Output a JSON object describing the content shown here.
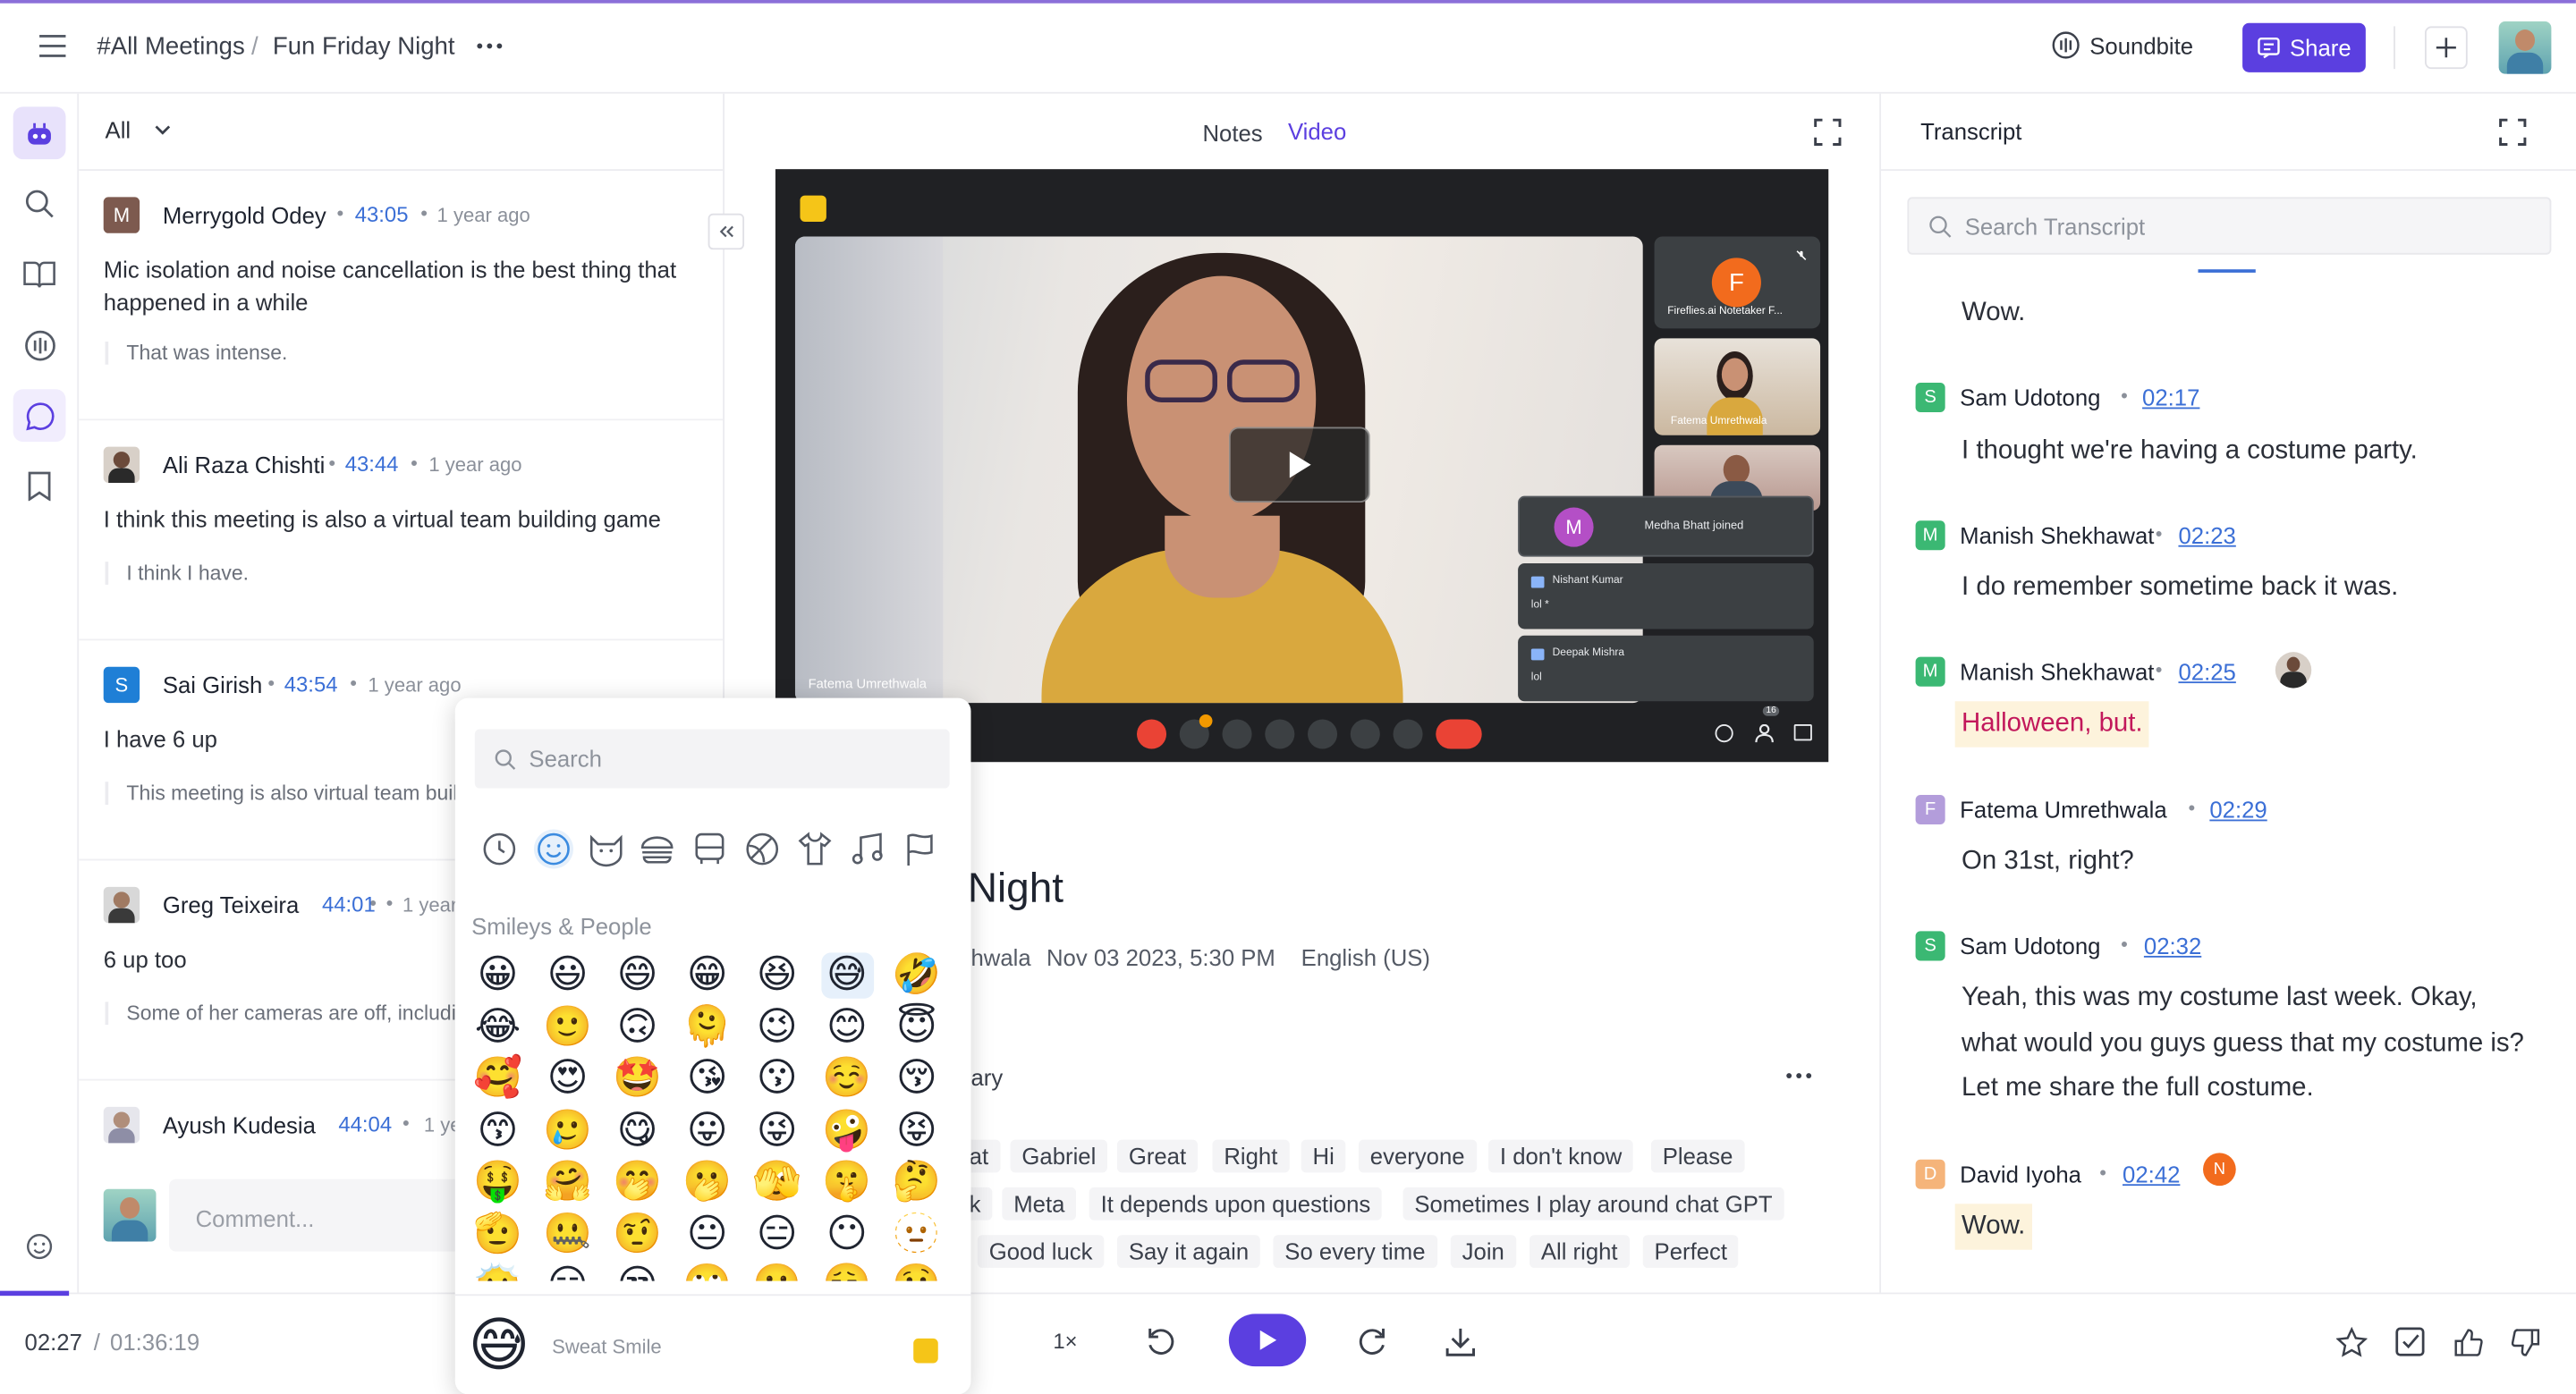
{
  "breadcrumb": {
    "root": "#All Meetings",
    "separator": "/",
    "current": "Fun Friday Night"
  },
  "header": {
    "soundbite": "Soundbite",
    "share": "Share"
  },
  "comments": {
    "filter": "All",
    "items": [
      {
        "name": "Merrygold Odey",
        "time": "43:05",
        "ago": "1 year ago",
        "text": "Mic isolation and noise cancellation is the best thing that happened in a while",
        "reply": "That was intense.",
        "initial": "M",
        "color": "#7d5a4f"
      },
      {
        "name": "Ali Raza Chishti",
        "time": "43:44",
        "ago": "1 year ago",
        "text": "I think this meeting is also a virtual team building game",
        "reply": "I think I have."
      },
      {
        "name": "Sai Girish",
        "time": "43:54",
        "ago": "1 year ago",
        "text": "I have 6 up",
        "reply": "This meeting is also virtual team buil",
        "initial": "S",
        "color": "#1f7fd6"
      },
      {
        "name": "Greg Teixeira",
        "time": "44:01",
        "ago": "1 year",
        "text": "6 up too",
        "reply": "Some of her cameras are off, includir"
      },
      {
        "name": "Ayush Kudesia",
        "time": "44:04",
        "ago": "1 ye"
      }
    ],
    "comment_placeholder": "Comment..."
  },
  "center": {
    "tabs": [
      {
        "label": "Notes"
      },
      {
        "label": "Video"
      }
    ],
    "video": {
      "tiles": [
        {
          "initial": "F",
          "label": "Fireflies.ai Notetaker F..."
        },
        {
          "label": "Fatema Umrethwala"
        },
        {
          "label": ""
        }
      ],
      "main_label": "Fatema Umrethwala",
      "notifications": [
        {
          "initial": "M",
          "text": "Medha Bhatt joined"
        },
        {
          "name": "Nishant Kumar",
          "text": "lol *"
        },
        {
          "name": "Deepak Mishra",
          "text": "lol"
        }
      ],
      "participant_count": "16"
    },
    "meeting": {
      "title_tail": "Night",
      "host_tail": "hwala",
      "date": "Nov 03 2023, 5:30 PM",
      "language": "English (US)",
      "section_tail": "ary"
    },
    "keywords": [
      [
        "at",
        "Gabriel",
        "Great",
        "Right",
        "Hi",
        "everyone",
        "I don't know",
        "Please"
      ],
      [
        "k",
        "Meta",
        "It depends upon questions",
        "Sometimes I play around chat GPT"
      ],
      [
        "Good luck",
        "Say it again",
        "So every time",
        "Join",
        "All right",
        "Perfect"
      ]
    ]
  },
  "transcript": {
    "title": "Transcript",
    "search_placeholder": "Search Transcript",
    "entries": [
      {
        "name": "",
        "time": "",
        "text": "Wow."
      },
      {
        "name": "Sam Udotong",
        "time": "02:17",
        "initial": "S",
        "color": "#3bb873",
        "text": "I thought we're having a costume party."
      },
      {
        "name": "Manish Shekhawat",
        "time": "02:23",
        "initial": "M",
        "color": "#3bb873",
        "text": "I do remember sometime back it was."
      },
      {
        "name": "Manish Shekhawat",
        "time": "02:25",
        "initial": "M",
        "color": "#3bb873",
        "text": "Halloween, but."
      },
      {
        "name": "Fatema Umrethwala",
        "time": "02:29",
        "initial": "F",
        "color": "#b39ddb",
        "text": "On 31st, right?"
      },
      {
        "name": "Sam Udotong",
        "time": "02:32",
        "initial": "S",
        "color": "#3bb873",
        "text": "Yeah, this was my costume last week. Okay, what would you guys guess that my costume is? Let me share the full costume."
      },
      {
        "name": "David Iyoha",
        "time": "02:42",
        "initial": "D",
        "color": "#f5b47a",
        "text": "Wow.",
        "badge": "N"
      }
    ]
  },
  "player": {
    "current": "02:27",
    "separator": "/",
    "total": "01:36:19",
    "speed": "1×"
  },
  "emoji_picker": {
    "search_placeholder": "Search",
    "category_title": "Smileys & People",
    "rows": [
      [
        "😀",
        "😃",
        "😄",
        "😁",
        "😆",
        "😅",
        "🤣"
      ],
      [
        "😂",
        "🙂",
        "🙃",
        "🫠",
        "😉",
        "😊",
        "😇"
      ],
      [
        "🥰",
        "😍",
        "🤩",
        "😘",
        "😗",
        "☺️",
        "😚"
      ],
      [
        "😙",
        "🥲",
        "😋",
        "😛",
        "😜",
        "🤪",
        "😝"
      ],
      [
        "🤑",
        "🤗",
        "🤭",
        "🫢",
        "🫣",
        "🤫",
        "🤔"
      ],
      [
        "🫡",
        "🤐",
        "🤨",
        "😐",
        "😑",
        "😶",
        "🫥"
      ],
      [
        "😶‍🌫️",
        "😏",
        "😒",
        "🙄",
        "😬",
        "😮‍💨",
        "🤥"
      ]
    ],
    "preview": {
      "emoji": "😅",
      "name": "Sweat Smile"
    }
  }
}
